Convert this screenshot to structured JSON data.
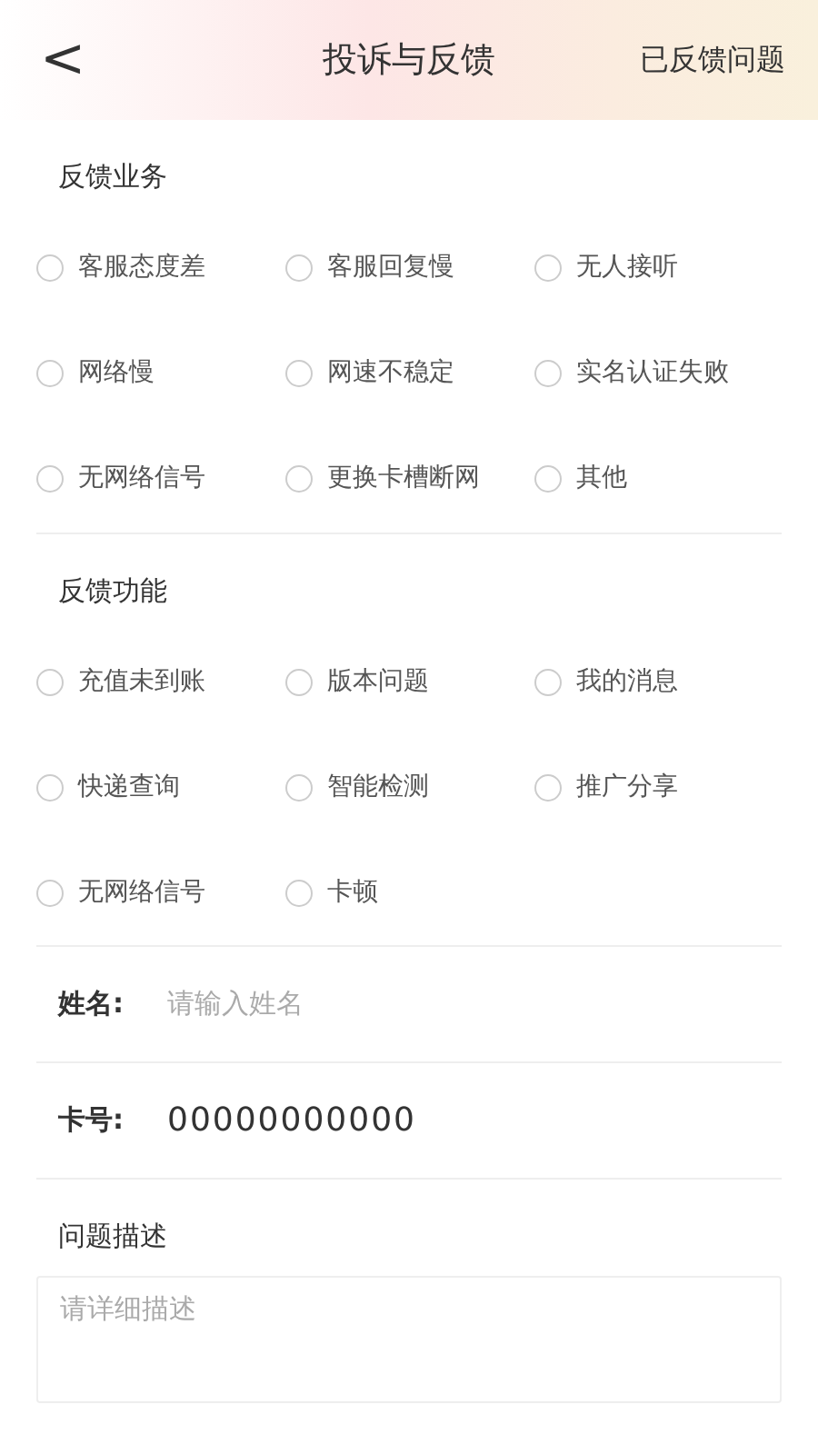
{
  "header": {
    "back": "<",
    "title": "投诉与反馈",
    "action": "已反馈问题"
  },
  "sections": [
    {
      "title": "反馈业务",
      "options": [
        {
          "label": "客服态度差",
          "selected": false
        },
        {
          "label": "客服回复慢",
          "selected": false
        },
        {
          "label": "无人接听",
          "selected": false
        },
        {
          "label": "网络慢",
          "selected": false
        },
        {
          "label": "网速不稳定",
          "selected": false
        },
        {
          "label": "实名认证失败",
          "selected": false
        },
        {
          "label": "无网络信号",
          "selected": false
        },
        {
          "label": "更换卡槽断网",
          "selected": false
        },
        {
          "label": "其他",
          "selected": false
        }
      ]
    },
    {
      "title": "反馈功能",
      "options": [
        {
          "label": "充值未到账",
          "selected": false
        },
        {
          "label": "版本问题",
          "selected": false
        },
        {
          "label": "我的消息",
          "selected": false
        },
        {
          "label": "快递查询",
          "selected": false
        },
        {
          "label": "智能检测",
          "selected": false
        },
        {
          "label": "推广分享",
          "selected": false
        },
        {
          "label": "无网络信号",
          "selected": false
        },
        {
          "label": "卡顿",
          "selected": false
        }
      ]
    }
  ],
  "fields": [
    {
      "label": "姓名:",
      "placeholder": "请输入姓名"
    },
    {
      "label": "卡号:",
      "value": "00000000000"
    }
  ],
  "description": {
    "label": "问题描述",
    "placeholder": "请详细描述"
  }
}
